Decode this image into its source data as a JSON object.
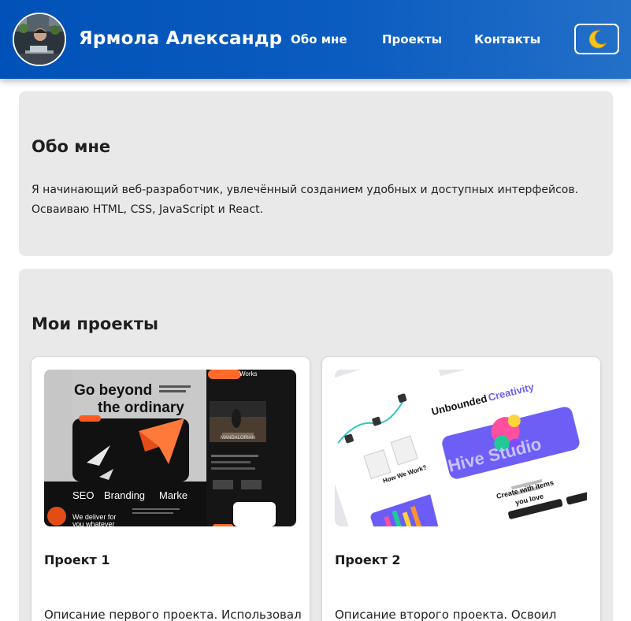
{
  "header": {
    "title": "Ярмола Александр",
    "nav": [
      {
        "label": "Обо мне"
      },
      {
        "label": "Проекты"
      },
      {
        "label": "Контакты"
      }
    ],
    "theme_toggle_icon": "crescent-moon-icon"
  },
  "about": {
    "title": "Обо мне",
    "text": "Я начинающий веб-разработчик, увлечённый созданием удобных и доступных интерфейсов. Осваиваю HTML, CSS, JavaScript и React."
  },
  "projects": {
    "title": "Мои проекты",
    "cards": [
      {
        "title": "Проект 1",
        "description": "Описание первого проекта. Использовал",
        "preview": {
          "headline_1": "Go beyond",
          "headline_2": "the ordinary",
          "tags": [
            "SEO",
            "Branding",
            "Marke"
          ],
          "footer_1": "We deliver for",
          "footer_2": "you whatever",
          "side_top": "Works",
          "side_caption": "MANDALORIAN"
        }
      },
      {
        "title": "Проект 2",
        "description": "Описание второго проекта. Освоил",
        "preview": {
          "headline_1": "Unbounded",
          "headline_2": "Creativity",
          "brand": "Hive Studio",
          "question": "How We Work?",
          "cta_1": "Create with items",
          "cta_2": "you love"
        }
      }
    ]
  },
  "colors": {
    "header_start": "#0152b8",
    "header_end": "#2370c8",
    "section_bg": "#e9e9e9",
    "moon": "#f7c31e"
  }
}
